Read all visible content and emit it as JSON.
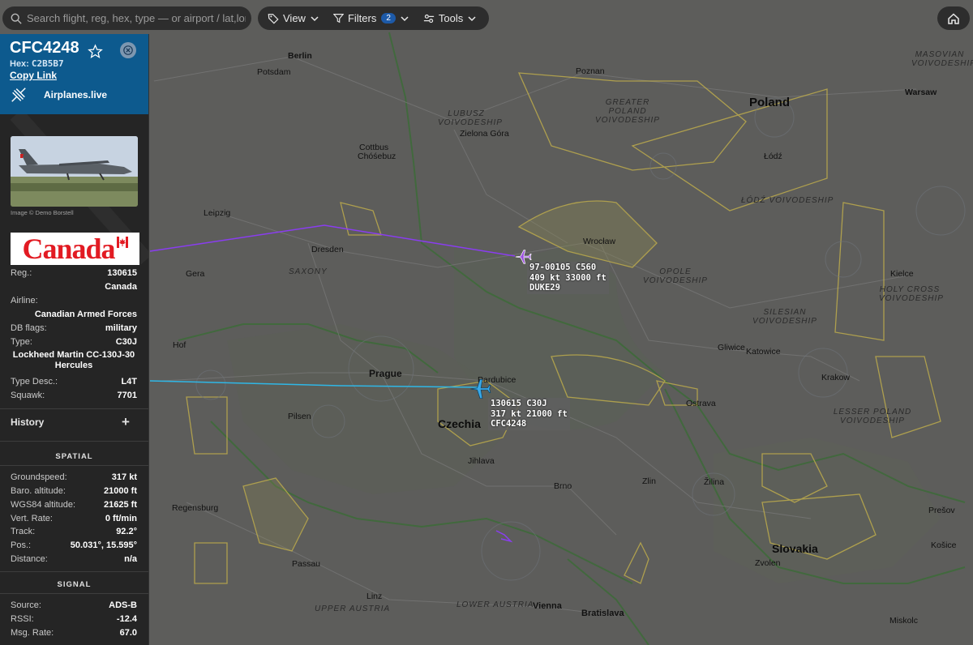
{
  "search": {
    "placeholder": "Search flight, reg, hex, type — or airport / lat,lon"
  },
  "toolbar": {
    "view_label": "View",
    "filters_label": "Filters",
    "filters_count": "2",
    "tools_label": "Tools"
  },
  "aircraft": {
    "callsign": "CFC4248",
    "hex_label": "Hex:",
    "hex": "C2B5B7",
    "copy_link": "Copy Link",
    "source_site": "Airplanes.live",
    "photo_credit": "Image © Demo Borstell",
    "flag_word": "Canada"
  },
  "details": {
    "reg_label": "Reg.:",
    "reg_value": "130615",
    "reg_country": "Canada",
    "airline_label": "Airline:",
    "airline_value": "Canadian Armed Forces",
    "dbflags_label": "DB flags:",
    "dbflags_value": "military",
    "type_label": "Type:",
    "type_value": "C30J",
    "type_name": "Lockheed Martin CC-130J-30 Hercules",
    "typedesc_label": "Type Desc.:",
    "typedesc_value": "L4T",
    "squawk_label": "Squawk:",
    "squawk_value": "7701"
  },
  "history_label": "History",
  "spatial": {
    "title": "SPATIAL",
    "groundspeed_label": "Groundspeed:",
    "groundspeed_value": "317 kt",
    "baro_label": "Baro. altitude:",
    "baro_value": "21000 ft",
    "wgs_label": "WGS84 altitude:",
    "wgs_value": "21625 ft",
    "vrate_label": "Vert. Rate:",
    "vrate_value": "0 ft/min",
    "track_label": "Track:",
    "track_value": "92.2°",
    "pos_label": "Pos.:",
    "pos_value": "50.031°, 15.595°",
    "distance_label": "Distance:",
    "distance_value": "n/a"
  },
  "signal": {
    "title": "SIGNAL",
    "source_label": "Source:",
    "source_value": "ADS-B",
    "rssi_label": "RSSI:",
    "rssi_value": "-12.4",
    "msgrate_label": "Msg. Rate:",
    "msgrate_value": "67.0"
  },
  "map_labels": {
    "cities": [
      "Berlin",
      "Potsdam",
      "Poznan",
      "Warsaw",
      "Zielona Góra",
      "Cottbus",
      "Chóśebuz",
      "Łódź",
      "Leipzig",
      "Dresden",
      "Wrocław",
      "Gera",
      "Kielce",
      "Hof",
      "Gliwice",
      "Katowice",
      "Prague",
      "Pardubice",
      "Krakow",
      "Ostrava",
      "Pilsen",
      "Jihlava",
      "Brno",
      "Zlin",
      "Žilina",
      "Regensburg",
      "Prešov",
      "Zvolen",
      "Passau",
      "Košice",
      "Linz",
      "Vienna",
      "Bratislava",
      "Miskolc"
    ],
    "countries": [
      "Poland",
      "Czechia",
      "Slovakia"
    ],
    "regions": [
      "MASOVIAN VOIVODESHIP",
      "LUBUSZ VOIVODESHIP",
      "GREATER POLAND VOIVODESHIP",
      "ŁÓDŹ VOIVODESHIP",
      "OPOLE VOIVODESHIP",
      "HOLY CROSS VOIVODESHIP",
      "SILESIAN VOIVODESHIP",
      "LESSER POLAND VOIVODESHIP",
      "SAXONY",
      "UPPER AUSTRIA",
      "LOWER AUSTRIA"
    ]
  },
  "traffic": [
    {
      "line1": "97-00105 C560",
      "line2": "409 kt  33000 ft",
      "line3": "DUKE29",
      "color": "#9b4de0"
    },
    {
      "line1": "130615 C30J",
      "line2": "317 kt  21000 ft",
      "line3": "CFC4248",
      "color": "#39a9e8"
    }
  ],
  "colors": {
    "panel_header": "#0d5a8e",
    "purple_track": "#8a3df0",
    "blue_track": "#2fb7e6",
    "airspace": "#d7c34a"
  }
}
